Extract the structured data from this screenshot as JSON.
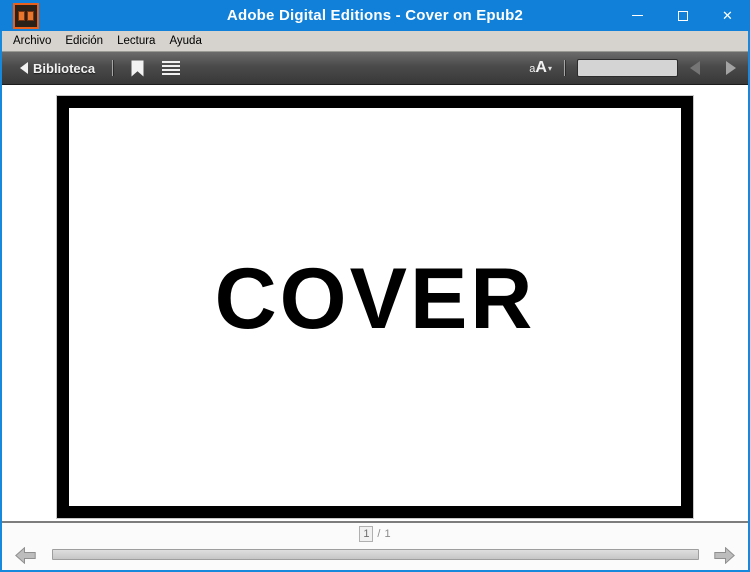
{
  "window": {
    "title": "Adobe Digital Editions - Cover on Epub2"
  },
  "menu": {
    "items": [
      {
        "label": "Archivo"
      },
      {
        "label": "Edición"
      },
      {
        "label": "Lectura"
      },
      {
        "label": "Ayuda"
      }
    ]
  },
  "toolbar": {
    "library_button": {
      "label": "Biblioteca"
    },
    "font_size_button": {
      "small": "a",
      "large": "A",
      "caret": "▾"
    },
    "search_input": {
      "value": "",
      "placeholder": ""
    }
  },
  "reader": {
    "cover_text": "COVER"
  },
  "pagination": {
    "current_page": "1",
    "separator": "/",
    "total_pages": "1"
  },
  "icons": {
    "close": "✕"
  },
  "colors": {
    "titlebar_blue": "#1080d8",
    "window_border_blue": "#1789dd",
    "menubar_gray": "#d6d3ce",
    "toolbar_dark": "#4a4a4a",
    "cover_border": "#000000",
    "app_icon_orange": "#e8601c"
  }
}
